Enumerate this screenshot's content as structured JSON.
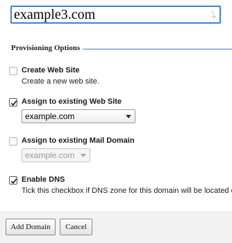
{
  "domain_input": {
    "value": "example3.com"
  },
  "provisioning": {
    "legend": "Provisioning Options",
    "create_web_site": {
      "label": "Create Web Site",
      "description": "Create a new web site.",
      "checked": false
    },
    "assign_web_site": {
      "label": "Assign to existing Web Site",
      "checked": true,
      "selected": "example.com"
    },
    "assign_mail_domain": {
      "label": "Assign to existing Mail Domain",
      "checked": false,
      "selected": "example.com"
    },
    "enable_dns": {
      "label": "Enable DNS",
      "description": "Tick this checkbox if DNS zone for this domain will be located o",
      "checked": true
    }
  },
  "buttons": {
    "add_domain": "Add Domain",
    "cancel": "Cancel"
  },
  "icons": {
    "spell": "spell-check-icon",
    "check": "checkmark-icon",
    "dropdown": "chevron-down-icon"
  }
}
